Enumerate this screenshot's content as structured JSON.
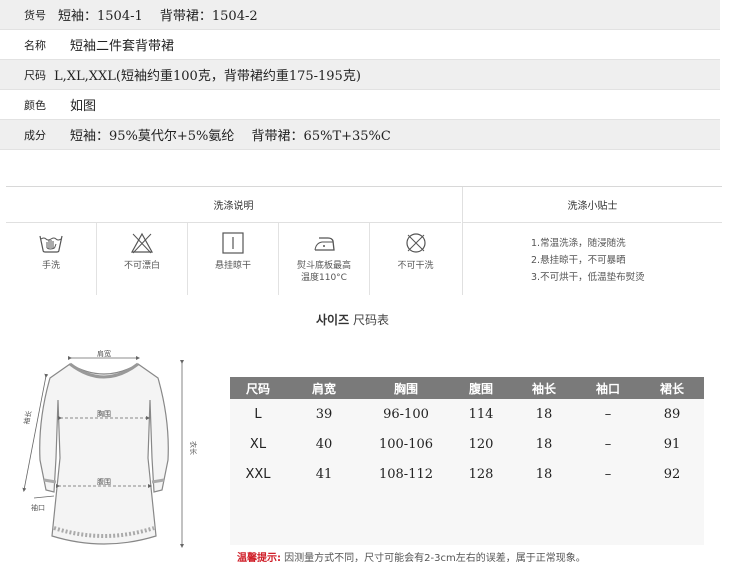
{
  "product_info": [
    {
      "label": "货号",
      "value": "短袖：1504-1　 背带裙：1504-2"
    },
    {
      "label": "名称",
      "value": "短袖二件套背带裙"
    },
    {
      "label": "尺码",
      "value": "L,XL,XXL(短袖约重100克，背带裙约重175-195克)"
    },
    {
      "label": "颜色",
      "value": "如图"
    },
    {
      "label": "成分",
      "value": "短袖：95%莫代尔+5%氨纶　 背带裙：65%T+35%C"
    }
  ],
  "washing": {
    "header_left": "洗涤说明",
    "header_right": "洗涤小贴士",
    "icons": [
      {
        "icon": "hand-wash-icon",
        "label": "手洗",
        "label2": ""
      },
      {
        "icon": "no-bleach-icon",
        "label": "不可漂白",
        "label2": ""
      },
      {
        "icon": "hang-dry-icon",
        "label": "悬挂晾干",
        "label2": ""
      },
      {
        "icon": "iron-icon",
        "label": "熨斗底板最高",
        "label2": "温度110°C"
      },
      {
        "icon": "no-dry-clean-icon",
        "label": "不可干洗",
        "label2": ""
      }
    ],
    "tips": [
      "1.常温洗涤，随浸随洗",
      "2.悬挂晾干，不可暴晒",
      "3.不可烘干，低温垫布熨烫"
    ]
  },
  "size_section": {
    "title_bold": "사이즈",
    "title_rest": " 尺码表"
  },
  "diagram_labels": {
    "shoulder": "肩宽",
    "chest": "胸围",
    "waist": "腹围",
    "sleeve": "袖长",
    "length": "衣长",
    "cuff": "袖口"
  },
  "size_table": {
    "columns": [
      "尺码",
      "肩宽",
      "胸围",
      "腹围",
      "袖长",
      "袖口",
      "裙长"
    ],
    "rows": [
      [
        "L",
        "39",
        "96-100",
        "114",
        "18",
        "–",
        "89"
      ],
      [
        "XL",
        "40",
        "100-106",
        "120",
        "18",
        "–",
        "91"
      ],
      [
        "XXL",
        "41",
        "108-112",
        "128",
        "18",
        "–",
        "92"
      ]
    ]
  },
  "note": {
    "prefix": "温馨提示:",
    "text": " 因测量方式不同，尺寸可能会有2-3cm左右的误差，属于正常现象。"
  }
}
